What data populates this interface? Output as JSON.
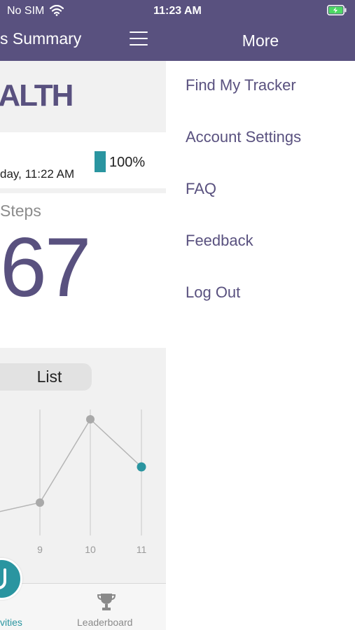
{
  "status_bar": {
    "carrier": "No SIM",
    "time": "11:23 AM"
  },
  "left_panel": {
    "header_title": "s Summary",
    "brand_text": "EALTH",
    "sync_time": "day, 11:22 AM",
    "battery_percent": "100%",
    "steps_label": "Steps",
    "steps_value": "67",
    "list_button": "List",
    "chart": {
      "x_ticks": [
        "9",
        "10",
        "11"
      ],
      "points": [
        {
          "x": 9,
          "value": "low"
        },
        {
          "x": 10,
          "value": "high"
        },
        {
          "x": 11,
          "value": "mid",
          "highlight": true
        }
      ]
    },
    "tabs": {
      "activities": "vities",
      "leaderboard": "Leaderboard"
    }
  },
  "more_menu": {
    "title": "More",
    "items": [
      "Find My Tracker",
      "Account Settings",
      "FAQ",
      "Feedback",
      "Log Out"
    ]
  },
  "colors": {
    "header": "#59517f",
    "accent": "#2a95a0",
    "text_dark": "#222222",
    "muted": "#8c8c8c"
  }
}
